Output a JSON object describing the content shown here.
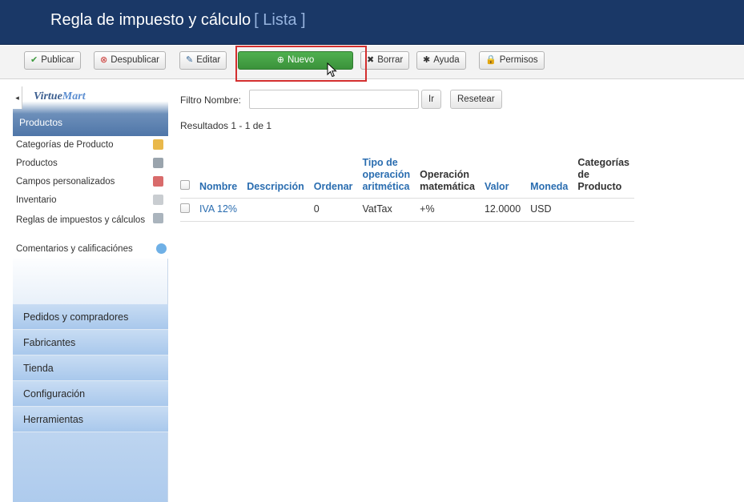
{
  "header": {
    "title": "Regla de impuesto y cálculo",
    "subtitle": "[ Lista ]"
  },
  "toolbar": {
    "publish": "Publicar",
    "unpublish": "Despublicar",
    "edit": "Editar",
    "new": "Nuevo",
    "delete": "Borrar",
    "help": "Ayuda",
    "permissions": "Permisos"
  },
  "sidebar": {
    "logo_text_a": "Virtue",
    "logo_text_b": "Mart",
    "section_title": "Productos",
    "items": [
      {
        "label": "Categorías de Producto",
        "icon": "folder-icon"
      },
      {
        "label": "Productos",
        "icon": "camera-icon"
      },
      {
        "label": "Campos personalizados",
        "icon": "fields-icon"
      },
      {
        "label": "Inventario",
        "icon": "chart-icon"
      },
      {
        "label": "Reglas de impuestos y cálculos",
        "icon": "calculator-icon"
      },
      {
        "label": "Comentarios y calificaciónes",
        "icon": "comment-icon"
      }
    ],
    "groups": [
      {
        "label": "Pedidos y compradores"
      },
      {
        "label": "Fabricantes"
      },
      {
        "label": "Tienda"
      },
      {
        "label": "Configuración"
      },
      {
        "label": "Herramientas"
      }
    ]
  },
  "filter": {
    "label": "Filtro Nombre:",
    "value": "",
    "go": "Ir",
    "reset": "Resetear",
    "results": "Resultados 1 - 1 de 1"
  },
  "table": {
    "headers": {
      "name": "Nombre",
      "description": "Descripción",
      "order": "Ordenar",
      "operation_type": "Tipo de operación aritmética",
      "math_operation": "Operación matemática",
      "value": "Valor",
      "currency": "Moneda",
      "categories": "Categorías de Producto"
    },
    "rows": [
      {
        "name": "IVA 12%",
        "description": "",
        "order": "0",
        "operation_type": "VatTax",
        "math_operation": "+%",
        "value": "12.0000",
        "currency": "USD",
        "categories": ""
      }
    ]
  },
  "colors": {
    "header_bg": "#1a3867",
    "accent_green": "#43a047",
    "link_blue": "#2a6db0",
    "highlight_red": "#d32f2f"
  }
}
